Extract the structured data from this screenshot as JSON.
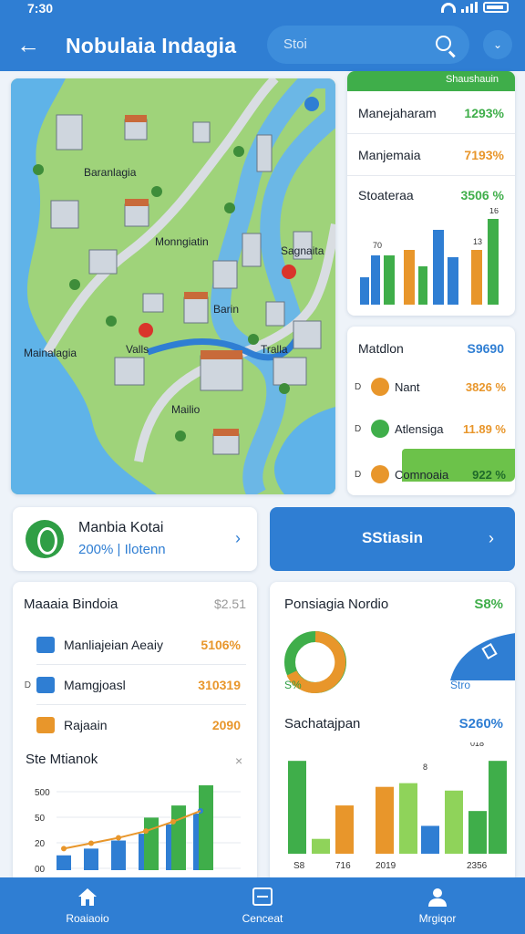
{
  "status_bar": {
    "time": "7:30"
  },
  "header": {
    "title": "Nobulaia Indagia",
    "search_placeholder": "Stoi"
  },
  "map": {
    "labels": [
      "Baranlagia",
      "Monngiatin",
      "Sagnaita",
      "Barin",
      "Mainalagia",
      "Valls",
      "Tralla",
      "Mailio"
    ]
  },
  "stats_card": {
    "header": "Shaushauin",
    "rows": [
      {
        "label": "Manejaharam",
        "value": "1293%"
      },
      {
        "label": "Manjemaia",
        "value": "7193%"
      },
      {
        "label": "Stoateraa",
        "value": "3506 %"
      }
    ],
    "bar_labels": [
      "70",
      "16",
      "13"
    ]
  },
  "detail_card": {
    "title": "Matdlon",
    "title_value": "S9690",
    "rows": [
      {
        "prefix": "D",
        "label": "Nant",
        "value": "3826 %"
      },
      {
        "prefix": "D",
        "label": "Atlensiga",
        "value": "11.89 %"
      },
      {
        "prefix": "D",
        "label": "Comnoaia",
        "value": "922 %"
      }
    ]
  },
  "flow_card": {
    "title": "Manbia Kotai",
    "subtitle": "200% | Ilotenn"
  },
  "action_button": {
    "label": "SStiasin"
  },
  "list_card": {
    "title": "Maaaia Bindoia",
    "value": "$2.51",
    "items": [
      {
        "prefix": "",
        "label": "Manliajeian Aeaiy",
        "value": "5106%"
      },
      {
        "prefix": "D",
        "label": "Mamgjoasl",
        "value": "310319"
      },
      {
        "prefix": "",
        "label": "Rajaain",
        "value": "2090"
      }
    ],
    "chart_title": "Ste Mtianok",
    "y_ticks": [
      "500",
      "50",
      "20",
      "00"
    ]
  },
  "report_card": {
    "title": "Ponsiagia Nordio",
    "value": "S8%",
    "donut_label": "S%",
    "stro_label": "Stro",
    "subtitle": "Sachatajpan",
    "subtitle_value": "S260%",
    "bar_labels": [
      "S8",
      "716",
      "2019",
      "2356"
    ],
    "top_labels": [
      "018",
      "8"
    ]
  },
  "chart_data": [
    {
      "type": "bar",
      "title": "Ste Mtianok",
      "y_ticks": [
        "500",
        "50",
        "20",
        "00"
      ],
      "series": [
        {
          "values": [
            22,
            32,
            44,
            54,
            68,
            84
          ]
        },
        {
          "values": [
            28,
            42,
            58,
            78,
            96,
            126
          ]
        }
      ],
      "trend": [
        32,
        40,
        48,
        58,
        72,
        88
      ],
      "ylim": [
        0,
        130
      ]
    },
    {
      "type": "bar",
      "title": "Sachatajpan",
      "categories": [
        "S8",
        "716",
        "2019",
        "2356"
      ],
      "values": [
        100,
        16,
        52,
        72,
        76,
        30,
        68,
        46,
        100
      ],
      "ylim": [
        0,
        110
      ]
    }
  ],
  "bottom_nav": {
    "items": [
      {
        "label": "Roaiaoio"
      },
      {
        "label": "Cenceat"
      },
      {
        "label": "Mrgiqor"
      }
    ]
  },
  "colors": {
    "primary": "#2f7ed3",
    "green": "#3fae4a",
    "orange": "#e8962b"
  }
}
